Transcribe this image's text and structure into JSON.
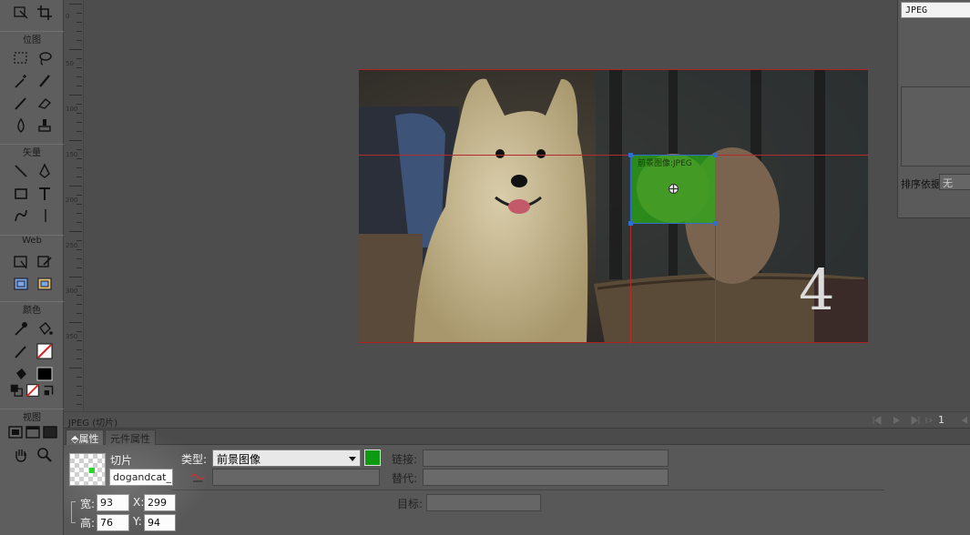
{
  "toolbox": {
    "sections": {
      "bitmap": "位图",
      "vector": "矢量",
      "web": "Web",
      "colors": "颜色",
      "view": "视图"
    },
    "icons": [
      "pointer-scale-icon",
      "crop-icon",
      "marquee-icon",
      "lasso-icon",
      "magic-wand-icon",
      "brush-icon",
      "pencil-icon",
      "eraser-icon",
      "blur-icon",
      "rubber-stamp-icon",
      "line-icon",
      "pen-icon",
      "rectangle-icon",
      "text-icon",
      "freeform-icon",
      "knife-icon",
      "hotspot-icon",
      "slice-icon",
      "hide-slices-icon",
      "show-slices-icon",
      "eyedropper-icon",
      "paint-bucket-icon",
      "stroke-color-icon",
      "fill-color-icon",
      "standard-screen-icon",
      "full-screen-menu-icon",
      "full-screen-icon",
      "hand-icon",
      "zoom-icon"
    ],
    "colors": {
      "stroke": "#e02020",
      "fill": "#000000"
    }
  },
  "ruler": {
    "labels": [
      "0",
      "50",
      "100",
      "150",
      "200",
      "250",
      "300",
      "350"
    ]
  },
  "canvas": {
    "slice_caption": "前景图像:JPEG",
    "big_number": "4",
    "guide_color": "#b52a2a",
    "slice_color": "#28aa14"
  },
  "right_panel": {
    "format_item": "JPEG",
    "sort_label": "排序依据:",
    "sort_value": "无"
  },
  "status_bar": {
    "text": "JPEG (切片)",
    "page": "1"
  },
  "properties": {
    "tabs": [
      "属性",
      "元件属性"
    ],
    "slice_label": "切片",
    "slice_name": "dogandcat_r",
    "width_label": "宽:",
    "width": "93",
    "height_label": "高:",
    "height": "76",
    "x_label": "X:",
    "x": "299",
    "y_label": "Y:",
    "y": "94",
    "type_label": "类型:",
    "type_value": "前景图像",
    "swatch_color": "#0d9a10",
    "link_label": "链接:",
    "link_value": "",
    "alt_label": "替代:",
    "alt_value": "",
    "target_label": "目标:",
    "target_value": "",
    "secondary_select": ""
  }
}
